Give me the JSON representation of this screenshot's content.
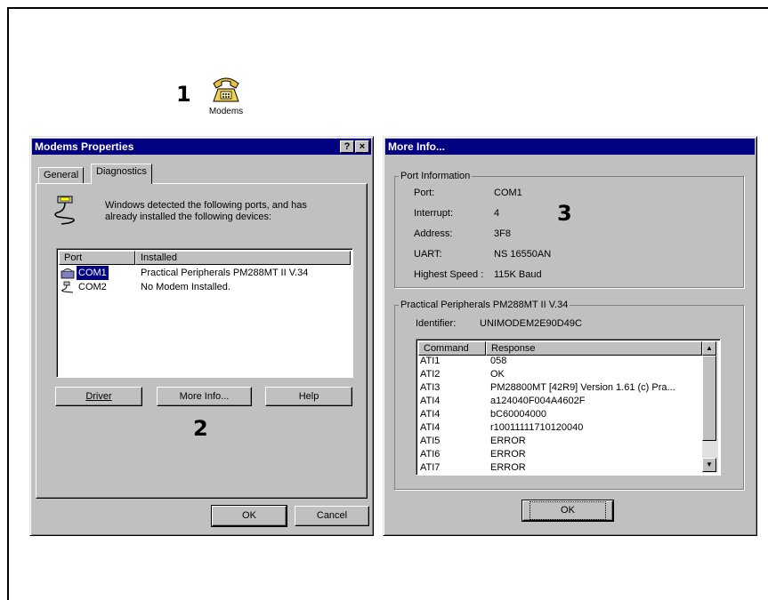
{
  "callouts": [
    "1",
    "2",
    "3"
  ],
  "desktop_icon": {
    "label": "Modems",
    "icon": "telephone-icon"
  },
  "modems_properties": {
    "title": "Modems Properties",
    "help_glyph": "?",
    "close_glyph": "×",
    "tabs": [
      "General",
      "Diagnostics"
    ],
    "intro_text": "Windows detected the following ports, and has already installed the following devices:",
    "columns": [
      "Port",
      "Installed"
    ],
    "rows": [
      {
        "port": "COM1",
        "installed": "Practical Peripherals PM288MT II V.34",
        "icon": "modem-icon"
      },
      {
        "port": "COM2",
        "installed": "No Modem Installed.",
        "icon": "serial-port-icon"
      }
    ],
    "buttons": {
      "driver": "Driver",
      "more_info": "More Info...",
      "help": "Help",
      "ok": "OK",
      "cancel": "Cancel"
    }
  },
  "more_info": {
    "title": "More Info...",
    "port_group_label": "Port Information",
    "port_fields": [
      {
        "label": "Port:",
        "value": "COM1"
      },
      {
        "label": "Interrupt:",
        "value": "4"
      },
      {
        "label": "Address:",
        "value": "3F8"
      },
      {
        "label": "UART:",
        "value": "NS 16550AN"
      },
      {
        "label": "Highest Speed :",
        "value": "115K Baud"
      }
    ],
    "device_group_label": "Practical Peripherals PM288MT II V.34",
    "identifier_label": "Identifier:",
    "identifier_value": "UNIMODEM2E90D49C",
    "columns": [
      "Command",
      "Response"
    ],
    "rows": [
      {
        "command": "ATI1",
        "response": "058"
      },
      {
        "command": "ATI2",
        "response": "OK"
      },
      {
        "command": "ATI3",
        "response": "PM28800MT [42R9] Version 1.61 (c) Pra..."
      },
      {
        "command": "ATI4",
        "response": "a124040F004A4602F"
      },
      {
        "command": "ATI4",
        "response": "bC60004000"
      },
      {
        "command": "ATI4",
        "response": "r10011111710120040"
      },
      {
        "command": "ATI5",
        "response": "ERROR"
      },
      {
        "command": "ATI6",
        "response": "ERROR"
      },
      {
        "command": "ATI7",
        "response": "ERROR"
      }
    ],
    "ok_label": "OK"
  }
}
